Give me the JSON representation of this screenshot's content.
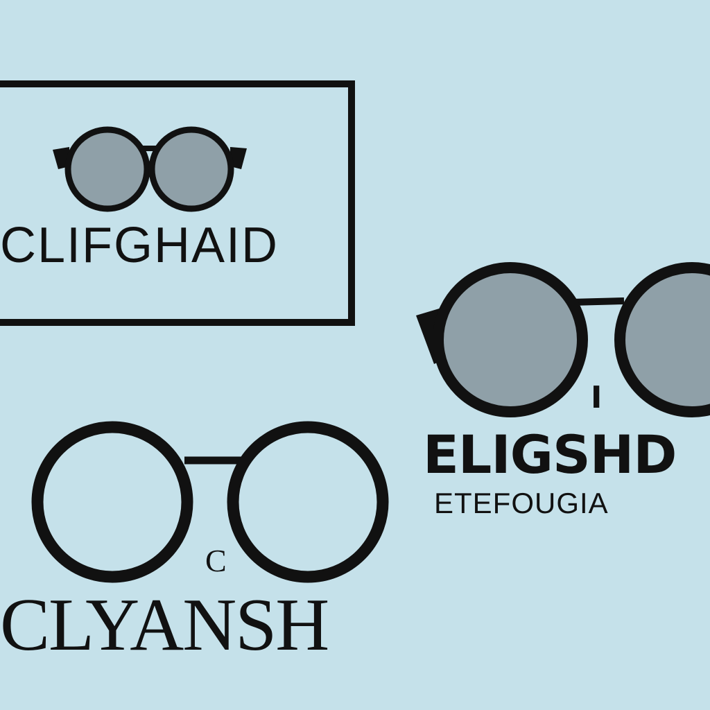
{
  "colors": {
    "background": "#c5e1ea",
    "ink": "#111111",
    "lens": "#8fa0a8"
  },
  "logos": [
    {
      "icon": "round-sunglasses-icon",
      "wordmark": "CLIFGHAID",
      "framed": true
    },
    {
      "icon": "round-sunglasses-icon",
      "wordmark": "ELIGSHD",
      "tagline": "ETEFOUGIA",
      "mark": "I"
    },
    {
      "icon": "round-glasses-icon",
      "wordmark": "CLYANSH",
      "mark": "C"
    }
  ]
}
